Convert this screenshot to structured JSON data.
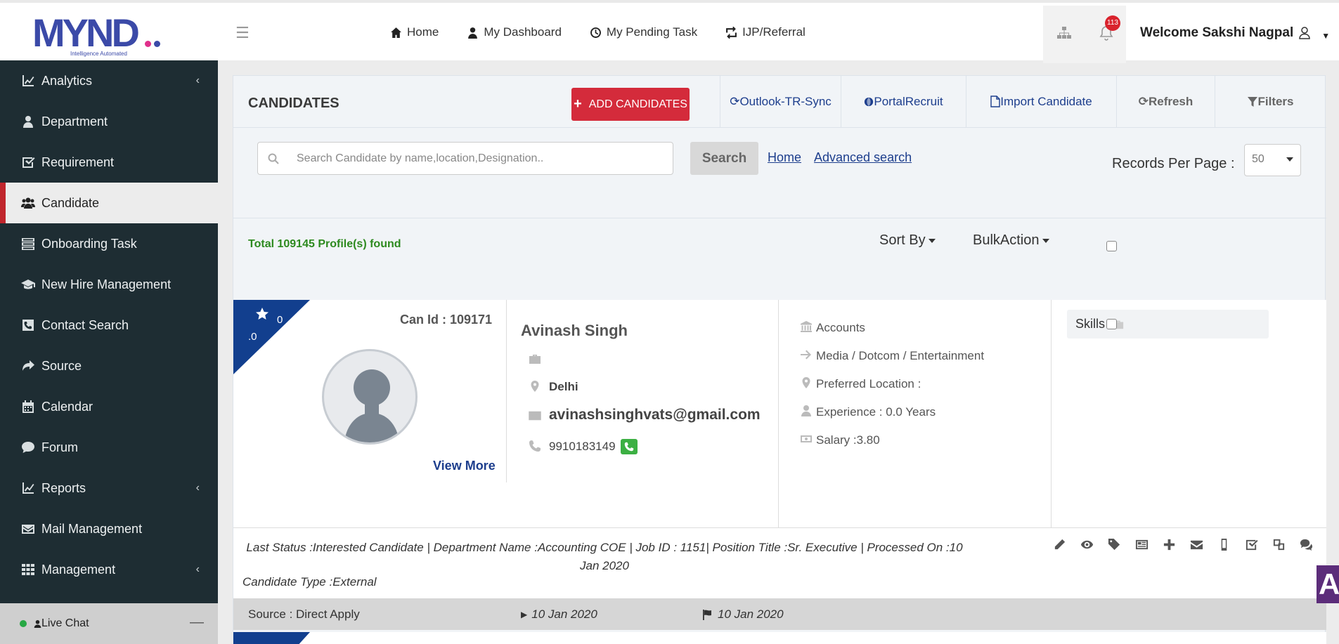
{
  "brand": {
    "logo_text": "MYND",
    "tagline": "Intelligence Automated"
  },
  "topnav": [
    {
      "label": "Home",
      "icon": "home-icon"
    },
    {
      "label": "My Dashboard",
      "icon": "user-icon"
    },
    {
      "label": "My Pending Task",
      "icon": "clock-icon"
    },
    {
      "label": "IJP/Referral",
      "icon": "retweet-icon"
    }
  ],
  "notifications": {
    "count": "113"
  },
  "user": {
    "welcome": "Welcome Sakshi Nagpal"
  },
  "sidebar": {
    "items": [
      {
        "label": "Analytics",
        "icon": "line-chart-icon",
        "has_sub": true
      },
      {
        "label": "Department",
        "icon": "user-icon",
        "has_sub": false
      },
      {
        "label": "Requirement",
        "icon": "checkbox-icon",
        "has_sub": false
      },
      {
        "label": "Candidate",
        "icon": "users-icon",
        "has_sub": false,
        "active": true
      },
      {
        "label": "Onboarding Task",
        "icon": "tasks-icon",
        "has_sub": false
      },
      {
        "label": "New Hire Management",
        "icon": "graduation-cap-icon",
        "has_sub": false
      },
      {
        "label": "Contact Search",
        "icon": "phone-square-icon",
        "has_sub": false
      },
      {
        "label": "Source",
        "icon": "share-icon",
        "has_sub": false
      },
      {
        "label": "Calendar",
        "icon": "calendar-icon",
        "has_sub": false
      },
      {
        "label": "Forum",
        "icon": "comment-icon",
        "has_sub": false
      },
      {
        "label": "Reports",
        "icon": "line-chart-icon",
        "has_sub": true
      },
      {
        "label": "Mail Management",
        "icon": "envelope-icon",
        "has_sub": false
      },
      {
        "label": "Management",
        "icon": "grid-icon",
        "has_sub": true
      }
    ],
    "live_chat": "Live Chat"
  },
  "candidates": {
    "title": "CANDIDATES",
    "add_button": "ADD CANDIDATES",
    "toolbar": [
      {
        "label": "Outlook-TR-Sync",
        "icon": "refresh-icon"
      },
      {
        "label": "PortalRecruit",
        "icon": "globe-icon"
      },
      {
        "label": "Import Candidate",
        "icon": "file-icon"
      },
      {
        "label": "Refresh",
        "icon": "refresh-icon"
      },
      {
        "label": "Filters",
        "icon": "filter-icon"
      }
    ],
    "search": {
      "placeholder": "Search Candidate by name,location,Designation..",
      "button": "Search",
      "home_link": "Home",
      "advanced_link": "Advanced search"
    },
    "records_per_page": {
      "label": "Records Per Page :",
      "value": "50"
    },
    "total": "Total 109145 Profile(s) found",
    "sort_by": "Sort By",
    "bulk_action": "BulkAction"
  },
  "card": {
    "rating_whole": "0",
    "rating_decimal": ".0",
    "can_id": "Can Id : 109171",
    "view_more": "View More",
    "name": "Avinash Singh",
    "city": "Delhi",
    "email": "avinashsinghvats@gmail.com",
    "phone": "9910183149",
    "department": "Accounts",
    "industry": "Media / Dotcom / Entertainment",
    "preferred_location": "Preferred Location :",
    "experience": "Experience : 0.0 Years",
    "salary": "Salary :3.80",
    "skills": "Skills",
    "status_line": "Last Status :Interested Candidate | Department Name :Accounting COE | Job ID : 1151| Position Title :Sr. Executive | Processed On :10 Jan 2020",
    "candidate_type": "Candidate Type :External",
    "source": "Source : Direct Apply",
    "date_applied": "10 Jan 2020",
    "date_flag": "10 Jan 2020"
  },
  "corner_widget": "A"
}
